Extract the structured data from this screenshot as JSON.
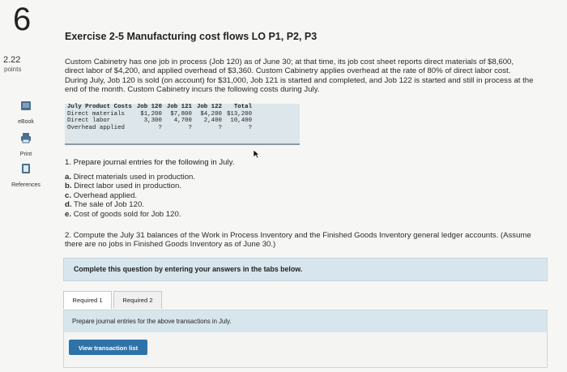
{
  "question": {
    "number": "6",
    "points_value": "2.22",
    "points_label": "points"
  },
  "sidebar": [
    {
      "label": "eBook",
      "icon": "book-icon"
    },
    {
      "label": "Print",
      "icon": "printer-icon"
    },
    {
      "label": "References",
      "icon": "references-icon"
    }
  ],
  "title": "Exercise 2-5 Manufacturing cost flows LO P1, P2, P3",
  "intro_lines": [
    "Custom Cabinetry has one job in process (Job 120) as of June 30; at that time, its job cost sheet reports direct materials of $8,600,",
    "direct labor of $4,200, and applied overhead of $3,360. Custom Cabinetry applies overhead at the rate of 80% of direct labor cost.",
    "During July, Job 120 is sold (on account) for $31,000, Job 121 is started and completed, and Job 122 is started and still in process at the",
    "end of the month. Custom Cabinetry incurs the following costs during July."
  ],
  "cost_table": {
    "headers": [
      "July Product Costs",
      "Job 120",
      "Job 121",
      "Job 122",
      "Total"
    ],
    "rows": [
      [
        "Direct materials",
        "$1,200",
        "$7,800",
        "$4,200",
        "$13,200"
      ],
      [
        "Direct labor",
        "3,300",
        "4,700",
        "2,400",
        "10,400"
      ],
      [
        "Overhead applied",
        "?",
        "?",
        "?",
        "?"
      ]
    ]
  },
  "q1": "1. Prepare journal entries for the following in July.",
  "parts": [
    {
      "letter": "a.",
      "text": "Direct materials used in production."
    },
    {
      "letter": "b.",
      "text": "Direct labor used in production."
    },
    {
      "letter": "c.",
      "text": "Overhead applied."
    },
    {
      "letter": "d.",
      "text": "The sale of Job 120."
    },
    {
      "letter": "e.",
      "text": "Cost of goods sold for Job 120."
    }
  ],
  "q2_lines": [
    "2. Compute the July 31 balances of the Work in Process Inventory and the Finished Goods Inventory general ledger accounts. (Assume",
    "there are no jobs in Finished Goods Inventory as of June 30.)"
  ],
  "complete_instruction": "Complete this question by entering your answers in the tabs below.",
  "tabs": [
    {
      "label": "Required 1",
      "active": true
    },
    {
      "label": "Required 2",
      "active": false
    }
  ],
  "prepare_text": "Prepare journal entries for the above transactions in July.",
  "view_button": "View transaction list"
}
